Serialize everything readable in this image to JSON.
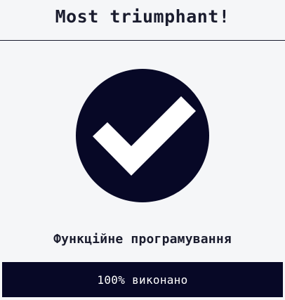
{
  "header": {
    "title": "Most triumphant!"
  },
  "badge": {
    "icon": "checkmark-icon",
    "circle_color": "#070826",
    "check_color": "#ffffff"
  },
  "course": {
    "title": "Функційне програмування"
  },
  "progress": {
    "percent": 100,
    "label": "100% виконано"
  }
}
